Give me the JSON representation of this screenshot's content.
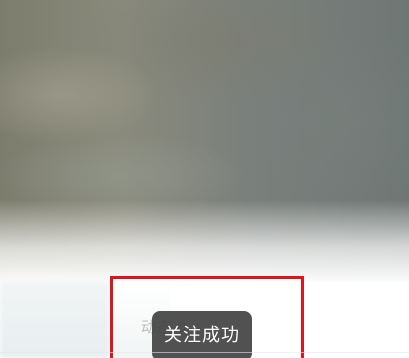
{
  "profile": {
    "dynamics_label": "动态 0"
  },
  "toast": {
    "message": "关注成功"
  },
  "colors": {
    "highlight_border": "#e0151b",
    "toast_background": "#444444",
    "toast_text": "#ffffff",
    "muted_text": "#b9b9b9"
  }
}
